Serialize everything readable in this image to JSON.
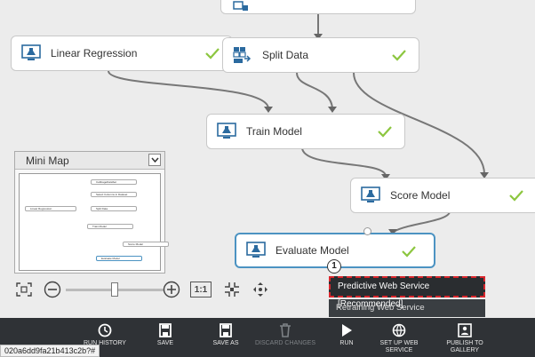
{
  "nodes": {
    "linear_regression": "Linear Regression",
    "split_data": "Split Data",
    "train_model": "Train Model",
    "score_model": "Score Model",
    "evaluate_model": "Evaluate Model"
  },
  "minimap": {
    "title": "Mini Map",
    "nodes": [
      "CabbageDataSet",
      "Select Columns in Dataset",
      "Linear Regression",
      "Split Data",
      "Train Model",
      "Score Model",
      "Evaluate Model"
    ]
  },
  "zoom": {
    "level_fraction": 0.5,
    "reset_label": "1:1"
  },
  "callout": {
    "step": "1",
    "primary": "Predictive Web Service [Recommended]",
    "secondary": "Retraining Web Service"
  },
  "toolbar": {
    "run_history": "RUN HISTORY",
    "save": "SAVE",
    "save_as": "SAVE AS",
    "discard": "DISCARD CHANGES",
    "run": "RUN",
    "setup_1": "SET UP WEB",
    "setup_2": "SERVICE",
    "publish_1": "PUBLISH TO",
    "publish_2": "GALLERY"
  },
  "status_url": "020a6dd9fa21b413c2b?#",
  "colors": {
    "accent": "#4c93c2",
    "check": "#8cc63f",
    "toolbar": "#2f3236",
    "callout_border": "#d9262c"
  }
}
